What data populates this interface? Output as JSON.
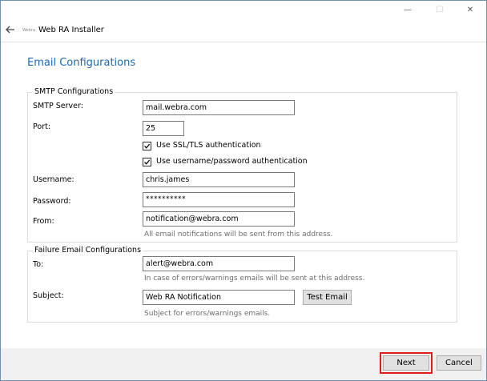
{
  "window": {
    "title": "Web RA  Installer",
    "logo_text": "Webra",
    "minimize_glyph": "—",
    "maximize_glyph": "☐",
    "close_glyph": "✕"
  },
  "page": {
    "title": "Email Configurations"
  },
  "smtp": {
    "legend": "SMTP Configurations",
    "server_label": "SMTP Server:",
    "server_value": "mail.webra.com",
    "port_label": "Port:",
    "port_value": "25",
    "ssl_label": "Use SSL/TLS authentication",
    "ssl_checked": true,
    "auth_label": "Use username/password authentication",
    "auth_checked": true,
    "username_label": "Username:",
    "username_value": "chris.james",
    "password_label": "Password:",
    "password_value": "**********",
    "from_label": "From:",
    "from_value": "notification@webra.com",
    "from_hint": "All email notifications will be sent from this address."
  },
  "failure": {
    "legend": "Failure Email Configurations",
    "to_label": "To:",
    "to_value": "alert@webra.com",
    "to_hint": "In case of errors/warnings emails will be sent at this address.",
    "subject_label": "Subject:",
    "subject_value": "Web RA Notification",
    "test_button": "Test Email",
    "subject_hint": "Subject for errors/warnings emails."
  },
  "footer": {
    "next_label": "Next",
    "cancel_label": "Cancel"
  },
  "colors": {
    "accent": "#1c68b4",
    "highlight": "#e21b1b"
  },
  "icons": {
    "back": "back-arrow-icon",
    "minimize": "minimize-icon",
    "maximize": "maximize-icon",
    "close": "close-icon",
    "checkbox": "checkmark-icon"
  }
}
